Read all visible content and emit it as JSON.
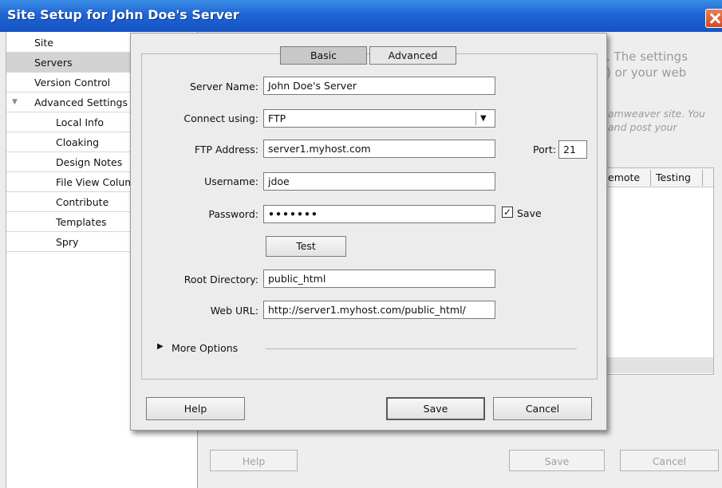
{
  "window": {
    "title": "Site Setup for John Doe's Server"
  },
  "sidebar": {
    "items": [
      {
        "label": "Site"
      },
      {
        "label": "Servers"
      },
      {
        "label": "Version Control"
      },
      {
        "label": "Advanced Settings"
      },
      {
        "label": "Local Info"
      },
      {
        "label": "Cloaking"
      },
      {
        "label": "Design Notes"
      },
      {
        "label": "File View Columns"
      },
      {
        "label": "Contribute"
      },
      {
        "label": "Templates"
      },
      {
        "label": "Spry"
      }
    ]
  },
  "background": {
    "text_line1": ". The settings",
    "text_line2": ") or your web",
    "italic_line1": "amweaver site. You",
    "italic_line2": "and post your",
    "columns": [
      "emote",
      "Testing"
    ],
    "buttons": {
      "help": "Help",
      "save": "Save",
      "cancel": "Cancel"
    }
  },
  "dialog": {
    "tabs": {
      "basic": "Basic",
      "advanced": "Advanced"
    },
    "server_name": {
      "label": "Server Name:",
      "value": "John Doe's Server"
    },
    "connect": {
      "label": "Connect using:",
      "value": "FTP"
    },
    "ftp_address": {
      "label": "FTP Address:",
      "value": "server1.myhost.com"
    },
    "port": {
      "label": "Port:",
      "value": "21"
    },
    "username": {
      "label": "Username:",
      "value": "jdoe"
    },
    "password": {
      "label": "Password:",
      "value": "•••••••",
      "save_label": "Save",
      "save_checked": true
    },
    "test_button": "Test",
    "root_directory": {
      "label": "Root Directory:",
      "value": "public_html"
    },
    "web_url": {
      "label": "Web URL:",
      "value": "http://server1.myhost.com/public_html/"
    },
    "more_options": "More Options",
    "buttons": {
      "help": "Help",
      "save": "Save",
      "cancel": "Cancel"
    }
  }
}
